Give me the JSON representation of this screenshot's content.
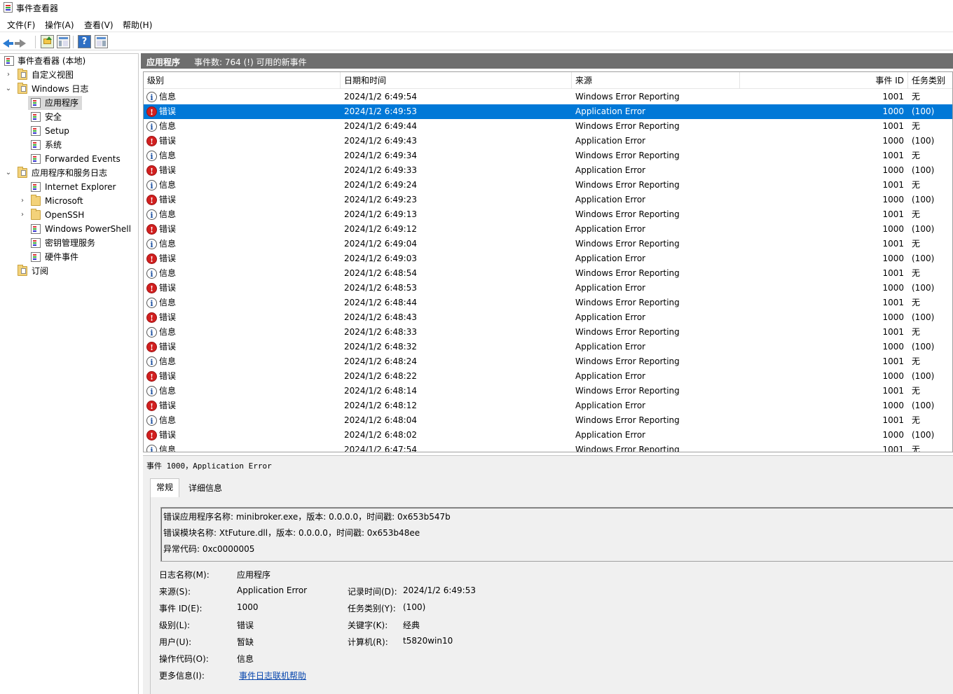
{
  "window": {
    "title": "事件查看器"
  },
  "menu": [
    "文件(F)",
    "操作(A)",
    "查看(V)",
    "帮助(H)"
  ],
  "toolbar": {
    "icons": [
      "back-arrow-icon",
      "forward-arrow-icon",
      "up-folder-icon",
      "show-hide-tree-icon",
      "help-icon",
      "show-action-pane-icon"
    ]
  },
  "tree": {
    "root": "事件查看器 (本地)",
    "custom_views": "自定义视图",
    "windows_logs": "Windows 日志",
    "application": "应用程序",
    "security": "安全",
    "setup": "Setup",
    "system": "系统",
    "forwarded": "Forwarded Events",
    "app_service_logs": "应用程序和服务日志",
    "internet_explorer": "Internet Explorer",
    "microsoft": "Microsoft",
    "openssh": "OpenSSH",
    "powershell": "Windows PowerShell",
    "key_mgmt": "密钥管理服务",
    "hardware": "硬件事件",
    "subscriptions": "订阅"
  },
  "log_header": {
    "name": "应用程序",
    "count": "事件数: 764 (!) 可用的新事件"
  },
  "columns": {
    "level": "级别",
    "datetime": "日期和时间",
    "source": "来源",
    "event_id": "事件 ID",
    "task_category": "任务类别"
  },
  "events": [
    {
      "level": "信息",
      "type": "info",
      "datetime": "2024/1/2 6:49:54",
      "source": "Windows Error Reporting",
      "id": "1001",
      "task": "无"
    },
    {
      "level": "错误",
      "type": "err",
      "datetime": "2024/1/2 6:49:53",
      "source": "Application Error",
      "id": "1000",
      "task": "(100)"
    },
    {
      "level": "信息",
      "type": "info",
      "datetime": "2024/1/2 6:49:44",
      "source": "Windows Error Reporting",
      "id": "1001",
      "task": "无"
    },
    {
      "level": "错误",
      "type": "err",
      "datetime": "2024/1/2 6:49:43",
      "source": "Application Error",
      "id": "1000",
      "task": "(100)"
    },
    {
      "level": "信息",
      "type": "info",
      "datetime": "2024/1/2 6:49:34",
      "source": "Windows Error Reporting",
      "id": "1001",
      "task": "无"
    },
    {
      "level": "错误",
      "type": "err",
      "datetime": "2024/1/2 6:49:33",
      "source": "Application Error",
      "id": "1000",
      "task": "(100)"
    },
    {
      "level": "信息",
      "type": "info",
      "datetime": "2024/1/2 6:49:24",
      "source": "Windows Error Reporting",
      "id": "1001",
      "task": "无"
    },
    {
      "level": "错误",
      "type": "err",
      "datetime": "2024/1/2 6:49:23",
      "source": "Application Error",
      "id": "1000",
      "task": "(100)"
    },
    {
      "level": "信息",
      "type": "info",
      "datetime": "2024/1/2 6:49:13",
      "source": "Windows Error Reporting",
      "id": "1001",
      "task": "无"
    },
    {
      "level": "错误",
      "type": "err",
      "datetime": "2024/1/2 6:49:12",
      "source": "Application Error",
      "id": "1000",
      "task": "(100)"
    },
    {
      "level": "信息",
      "type": "info",
      "datetime": "2024/1/2 6:49:04",
      "source": "Windows Error Reporting",
      "id": "1001",
      "task": "无"
    },
    {
      "level": "错误",
      "type": "err",
      "datetime": "2024/1/2 6:49:03",
      "source": "Application Error",
      "id": "1000",
      "task": "(100)"
    },
    {
      "level": "信息",
      "type": "info",
      "datetime": "2024/1/2 6:48:54",
      "source": "Windows Error Reporting",
      "id": "1001",
      "task": "无"
    },
    {
      "level": "错误",
      "type": "err",
      "datetime": "2024/1/2 6:48:53",
      "source": "Application Error",
      "id": "1000",
      "task": "(100)"
    },
    {
      "level": "信息",
      "type": "info",
      "datetime": "2024/1/2 6:48:44",
      "source": "Windows Error Reporting",
      "id": "1001",
      "task": "无"
    },
    {
      "level": "错误",
      "type": "err",
      "datetime": "2024/1/2 6:48:43",
      "source": "Application Error",
      "id": "1000",
      "task": "(100)"
    },
    {
      "level": "信息",
      "type": "info",
      "datetime": "2024/1/2 6:48:33",
      "source": "Windows Error Reporting",
      "id": "1001",
      "task": "无"
    },
    {
      "level": "错误",
      "type": "err",
      "datetime": "2024/1/2 6:48:32",
      "source": "Application Error",
      "id": "1000",
      "task": "(100)"
    },
    {
      "level": "信息",
      "type": "info",
      "datetime": "2024/1/2 6:48:24",
      "source": "Windows Error Reporting",
      "id": "1001",
      "task": "无"
    },
    {
      "level": "错误",
      "type": "err",
      "datetime": "2024/1/2 6:48:22",
      "source": "Application Error",
      "id": "1000",
      "task": "(100)"
    },
    {
      "level": "信息",
      "type": "info",
      "datetime": "2024/1/2 6:48:14",
      "source": "Windows Error Reporting",
      "id": "1001",
      "task": "无"
    },
    {
      "level": "错误",
      "type": "err",
      "datetime": "2024/1/2 6:48:12",
      "source": "Application Error",
      "id": "1000",
      "task": "(100)"
    },
    {
      "level": "信息",
      "type": "info",
      "datetime": "2024/1/2 6:48:04",
      "source": "Windows Error Reporting",
      "id": "1001",
      "task": "无"
    },
    {
      "level": "错误",
      "type": "err",
      "datetime": "2024/1/2 6:48:02",
      "source": "Application Error",
      "id": "1000",
      "task": "(100)"
    },
    {
      "level": "信息",
      "type": "info",
      "datetime": "2024/1/2 6:47:54",
      "source": "Windows Error Reporting",
      "id": "1001",
      "task": "无"
    }
  ],
  "selected_index": 1,
  "detail": {
    "title": "事件 1000，Application Error",
    "tabs": [
      "常规",
      "详细信息"
    ],
    "description": [
      "错误应用程序名称: minibroker.exe，版本: 0.0.0.0，时间戳: 0x653b547b",
      "错误模块名称: XtFuture.dll，版本: 0.0.0.0，时间戳: 0x653b48ee",
      "异常代码: 0xc0000005"
    ],
    "props": {
      "log_name_label": "日志名称(M):",
      "log_name": "应用程序",
      "source_label": "来源(S):",
      "source": "Application Error",
      "logged_label": "记录时间(D):",
      "logged": "2024/1/2 6:49:53",
      "event_id_label": "事件 ID(E):",
      "event_id": "1000",
      "task_label": "任务类别(Y):",
      "task": "(100)",
      "level_label": "级别(L):",
      "level": "错误",
      "keywords_label": "关键字(K):",
      "keywords": "经典",
      "user_label": "用户(U):",
      "user": "暂缺",
      "computer_label": "计算机(R):",
      "computer": "t5820win10",
      "opcode_label": "操作代码(O):",
      "opcode": "信息",
      "more_info_label": "更多信息(I):",
      "more_info_link": "事件日志联机帮助"
    }
  },
  "colors": {
    "selection": "#0078d7",
    "header": "#6e6e6e",
    "error": "#d21f1f",
    "link": "#0645ad"
  }
}
